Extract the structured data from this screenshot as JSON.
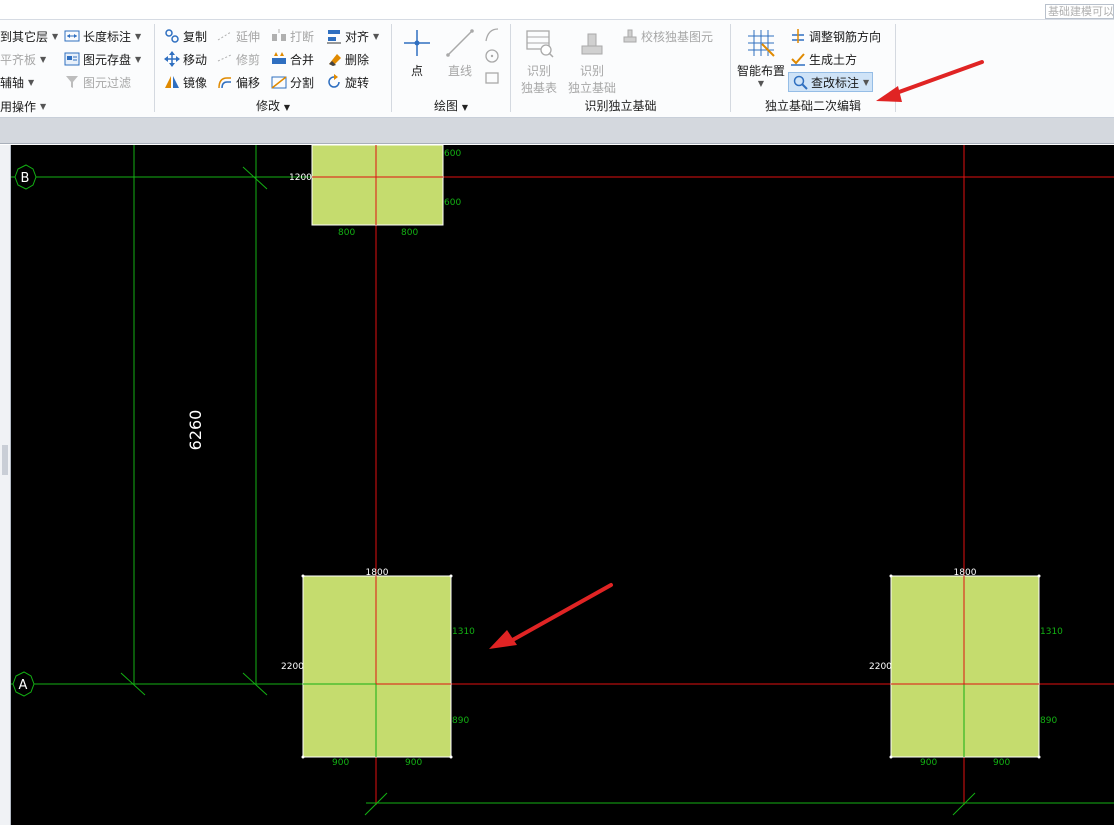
{
  "topbar": {
    "search_placeholder": "基础建模可以"
  },
  "ribbon": {
    "edit": {
      "copy_to_layer": "到其它层",
      "flat_board": "平齐板",
      "aux_axis": "辅轴",
      "common_ops": "用操作",
      "length_dim": "长度标注",
      "save_element": "图元存盘",
      "filter_element": "图元过滤"
    },
    "modify": {
      "label": "修改",
      "copy": "复制",
      "extend": "延伸",
      "break": "打断",
      "align": "对齐",
      "move": "移动",
      "trim": "修剪",
      "merge": "合并",
      "delete": "删除",
      "mirror": "镜像",
      "offset": "偏移",
      "split": "分割",
      "rotate": "旋转"
    },
    "draw": {
      "label": "绘图",
      "point": "点",
      "line": "直线"
    },
    "recognize": {
      "label": "识别独立基础",
      "recog_table_l1": "识别",
      "recog_table_l2": "独基表",
      "recog_found_l1": "识别",
      "recog_found_l2": "独立基础",
      "check_found": "校核独基图元"
    },
    "secondary": {
      "label": "独立基础二次编辑",
      "smart_layout": "智能布置",
      "adjust_rebar": "调整钢筋方向",
      "gen_earthwork": "生成土方",
      "edit_dim": "查改标注"
    }
  },
  "canvas": {
    "axis_b": "B",
    "axis_a": "A",
    "span_dim": "6260",
    "top_found": {
      "left": "1200",
      "right_top": "600",
      "right_bottom": "600",
      "bottom_left": "800",
      "bottom_right": "800"
    },
    "found_a1": {
      "top": "1800",
      "left": "2200",
      "right_top": "1310",
      "right_bottom": "890",
      "bottom_left": "900",
      "bottom_right": "900"
    },
    "found_a2": {
      "top": "1800",
      "left": "2200",
      "right_top": "1310",
      "right_bottom": "890",
      "bottom_left": "900",
      "bottom_right": "900"
    },
    "colors": {
      "foundation": "#c5dc6e",
      "axis_red": "#e01010",
      "axis_green": "#13b013",
      "bg": "#000000"
    }
  }
}
